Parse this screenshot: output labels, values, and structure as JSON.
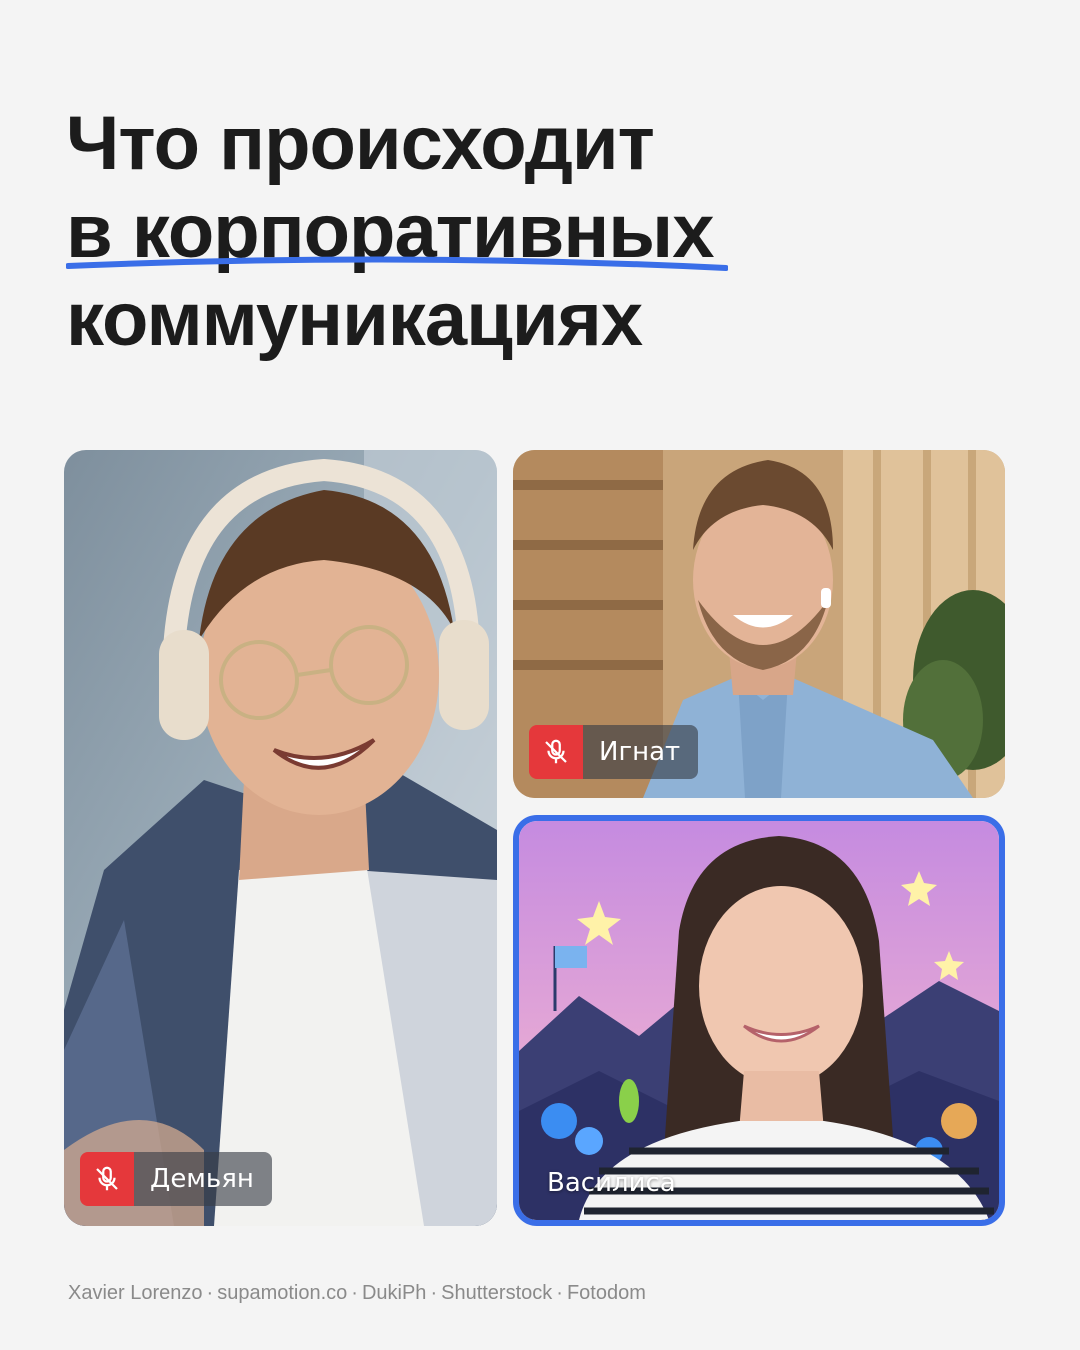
{
  "headline": {
    "line1": "Что происходит",
    "line2": "в корпоративных",
    "line3": "коммуникациях"
  },
  "accent_color": "#3a6ee8",
  "participants": [
    {
      "name": "Демьян",
      "muted": true,
      "icon": "mic-off-icon"
    },
    {
      "name": "Игнат",
      "muted": true,
      "icon": "mic-off-icon"
    },
    {
      "name": "Василиса",
      "muted": false,
      "active_speaker": true
    }
  ],
  "credits": {
    "items": [
      "Xavier Lorenzo",
      "supamotion.co",
      "DukiPh",
      "Shutterstock",
      "Fotodom"
    ],
    "separator": "·"
  }
}
